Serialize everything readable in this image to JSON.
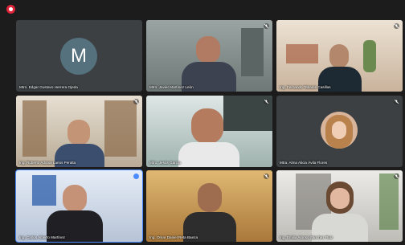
{
  "app": {
    "recording_icon": "record-icon",
    "mute_icon": "mic-off-icon"
  },
  "participants": [
    {
      "name": "Mtro. Edgar Gustavo Herrera Ojeda",
      "initial": "M",
      "muted": false
    },
    {
      "name": "Mtro. Javier Martínez León",
      "muted": true
    },
    {
      "name": "Ing. Fernando Tabarés Casillas",
      "muted": true
    },
    {
      "name": "Ing. Roberto Adonai Larios Peralta",
      "muted": true
    },
    {
      "name": "Mtro. Jesús García",
      "muted": true
    },
    {
      "name": "Mtra. Alma Alicia Ávila Flores",
      "muted": true
    },
    {
      "name": "Ing. Carlos Alberto Martínez",
      "muted": false,
      "speaking": true
    },
    {
      "name": "Ing. Omar Daniel Reta Baeza",
      "muted": true
    },
    {
      "name": "Ing. Emilia Alonso Sánchez Ruiz",
      "muted": true
    }
  ],
  "colors": {
    "background": "#1c1c1c",
    "tile": "#3c4043",
    "speaking": "#4a8cff",
    "avatar": "#54717d",
    "record": "#e0243a"
  }
}
